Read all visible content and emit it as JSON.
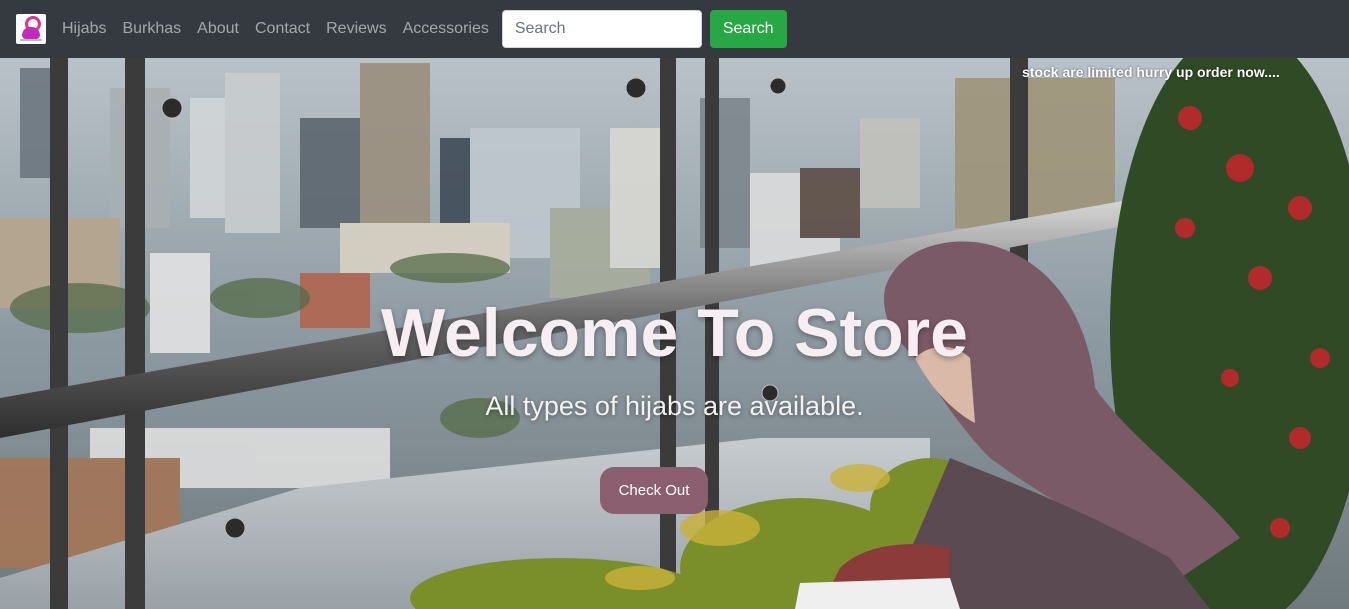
{
  "nav": {
    "logo_icon": "hijab-logo-icon",
    "links": [
      "Hijabs",
      "Burkhas",
      "About",
      "Contact",
      "Reviews",
      "Accessories"
    ],
    "search_placeholder": "Search",
    "search_button": "Search"
  },
  "hero": {
    "marquee": "stock are limited hurry up order now....",
    "title": "Welcome To Store",
    "subtitle": "All types of hijabs are available.",
    "cta": "Check Out"
  },
  "colors": {
    "navbar_bg": "#343a40",
    "search_button_bg": "#28a745",
    "cta_bg": "#8c5f70"
  }
}
